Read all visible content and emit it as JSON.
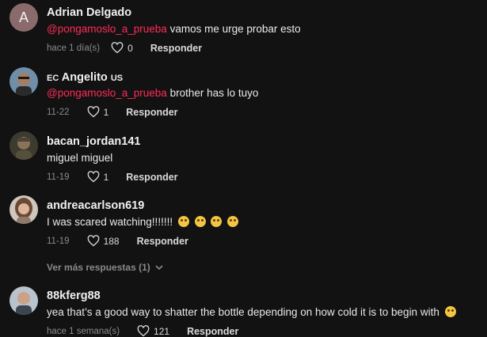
{
  "comments": [
    {
      "avatar_letter": "A",
      "author": "Adrian Delgado",
      "mention": "@pongamoslo_a_prueba",
      "text": " vamos me urge probar esto",
      "time": "hace 1 día(s)",
      "likes": "0",
      "reply": "Responder"
    },
    {
      "flag_left": "EC",
      "author": "Angelito",
      "flag_right": "US",
      "mention": "@pongamoslo_a_prueba",
      "text": " brother has lo tuyo",
      "time": "11-22",
      "likes": "1",
      "reply": "Responder"
    },
    {
      "author": "bacan_jordan141",
      "text": "miguel miguel",
      "time": "11-19",
      "likes": "1",
      "reply": "Responder"
    },
    {
      "author": "andreacarlson619",
      "text": "I was scared watching!!!!!!!",
      "time": "11-19",
      "likes": "188",
      "reply": "Responder",
      "more_replies": "Ver más respuestas (1)"
    },
    {
      "author": "88kferg88",
      "text": "yea that’s a good way to shatter the bottle depending on how cold it is to begin with",
      "time": "hace 1 semana(s)",
      "likes": "121",
      "reply": "Responder"
    }
  ]
}
